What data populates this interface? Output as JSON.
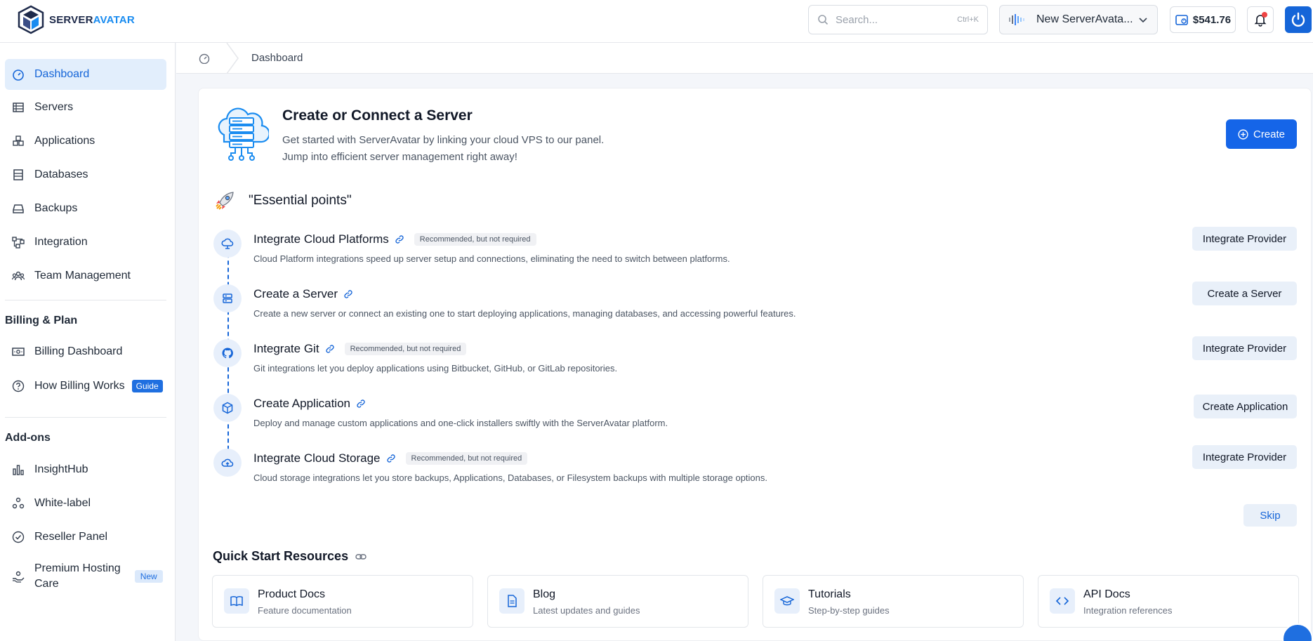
{
  "brand": {
    "name_part1": "SERVER",
    "name_part2": "AVATAR"
  },
  "header": {
    "search_placeholder": "Search...",
    "search_shortcut": "Ctrl+K",
    "server_name": "New ServerAvata...",
    "balance": "$541.76"
  },
  "breadcrumb": {
    "current": "Dashboard"
  },
  "sidebar": {
    "items": [
      {
        "label": "Dashboard",
        "icon": "dashboard-icon"
      },
      {
        "label": "Servers",
        "icon": "servers-icon"
      },
      {
        "label": "Applications",
        "icon": "applications-icon"
      },
      {
        "label": "Databases",
        "icon": "databases-icon"
      },
      {
        "label": "Backups",
        "icon": "backups-icon"
      },
      {
        "label": "Integration",
        "icon": "integration-icon"
      },
      {
        "label": "Team Management",
        "icon": "team-icon"
      }
    ],
    "billing_title": "Billing & Plan",
    "billing_items": [
      {
        "label": "Billing Dashboard",
        "icon": "billing-icon"
      },
      {
        "label": "How Billing Works",
        "icon": "help-icon",
        "badge": "Guide"
      }
    ],
    "addons_title": "Add-ons",
    "addon_items": [
      {
        "label": "InsightHub",
        "icon": "chart-icon"
      },
      {
        "label": "White-label",
        "icon": "whitelabel-icon"
      },
      {
        "label": "Reseller Panel",
        "icon": "check-circle-icon"
      },
      {
        "label_line1": "Premium Hosting",
        "label_line2": "Care",
        "icon": "care-icon",
        "badge": "New"
      }
    ]
  },
  "hero": {
    "title": "Create or Connect a Server",
    "subtitle_line1": "Get started with ServerAvatar by linking your cloud VPS to our panel.",
    "subtitle_line2": "Jump into efficient server management right away!",
    "create_label": "Create"
  },
  "essentials": {
    "title": "\"Essential points\"",
    "recommended_label": "Recommended, but not required",
    "steps": [
      {
        "title": "Integrate Cloud Platforms",
        "desc": "Cloud Platform integrations speed up server setup and connections, eliminating the need to switch between platforms.",
        "action": "Integrate Provider",
        "recommended": true
      },
      {
        "title": "Create a Server",
        "desc": "Create a new server or connect an existing one to start deploying applications, managing databases, and accessing powerful features.",
        "action": "Create a Server",
        "recommended": false
      },
      {
        "title": "Integrate Git",
        "desc": "Git integrations let you deploy applications using Bitbucket, GitHub, or GitLab repositories.",
        "action": "Integrate Provider",
        "recommended": true
      },
      {
        "title": "Create Application",
        "desc": "Deploy and manage custom applications and one-click installers swiftly with the ServerAvatar platform.",
        "action": "Create Application",
        "recommended": false
      },
      {
        "title": "Integrate Cloud Storage",
        "desc": "Cloud storage integrations let you store backups, Applications, Databases, or Filesystem backups with multiple storage options.",
        "action": "Integrate Provider",
        "recommended": true
      }
    ],
    "skip_label": "Skip"
  },
  "quick_start": {
    "title": "Quick Start Resources",
    "resources": [
      {
        "name": "Product Docs",
        "desc": "Feature documentation"
      },
      {
        "name": "Blog",
        "desc": "Latest updates and guides"
      },
      {
        "name": "Tutorials",
        "desc": "Step-by-step guides"
      },
      {
        "name": "API Docs",
        "desc": "Integration references"
      }
    ]
  },
  "colors": {
    "primary": "#1565d8",
    "accent": "#1a8cf0",
    "alert": "#ef4444"
  }
}
